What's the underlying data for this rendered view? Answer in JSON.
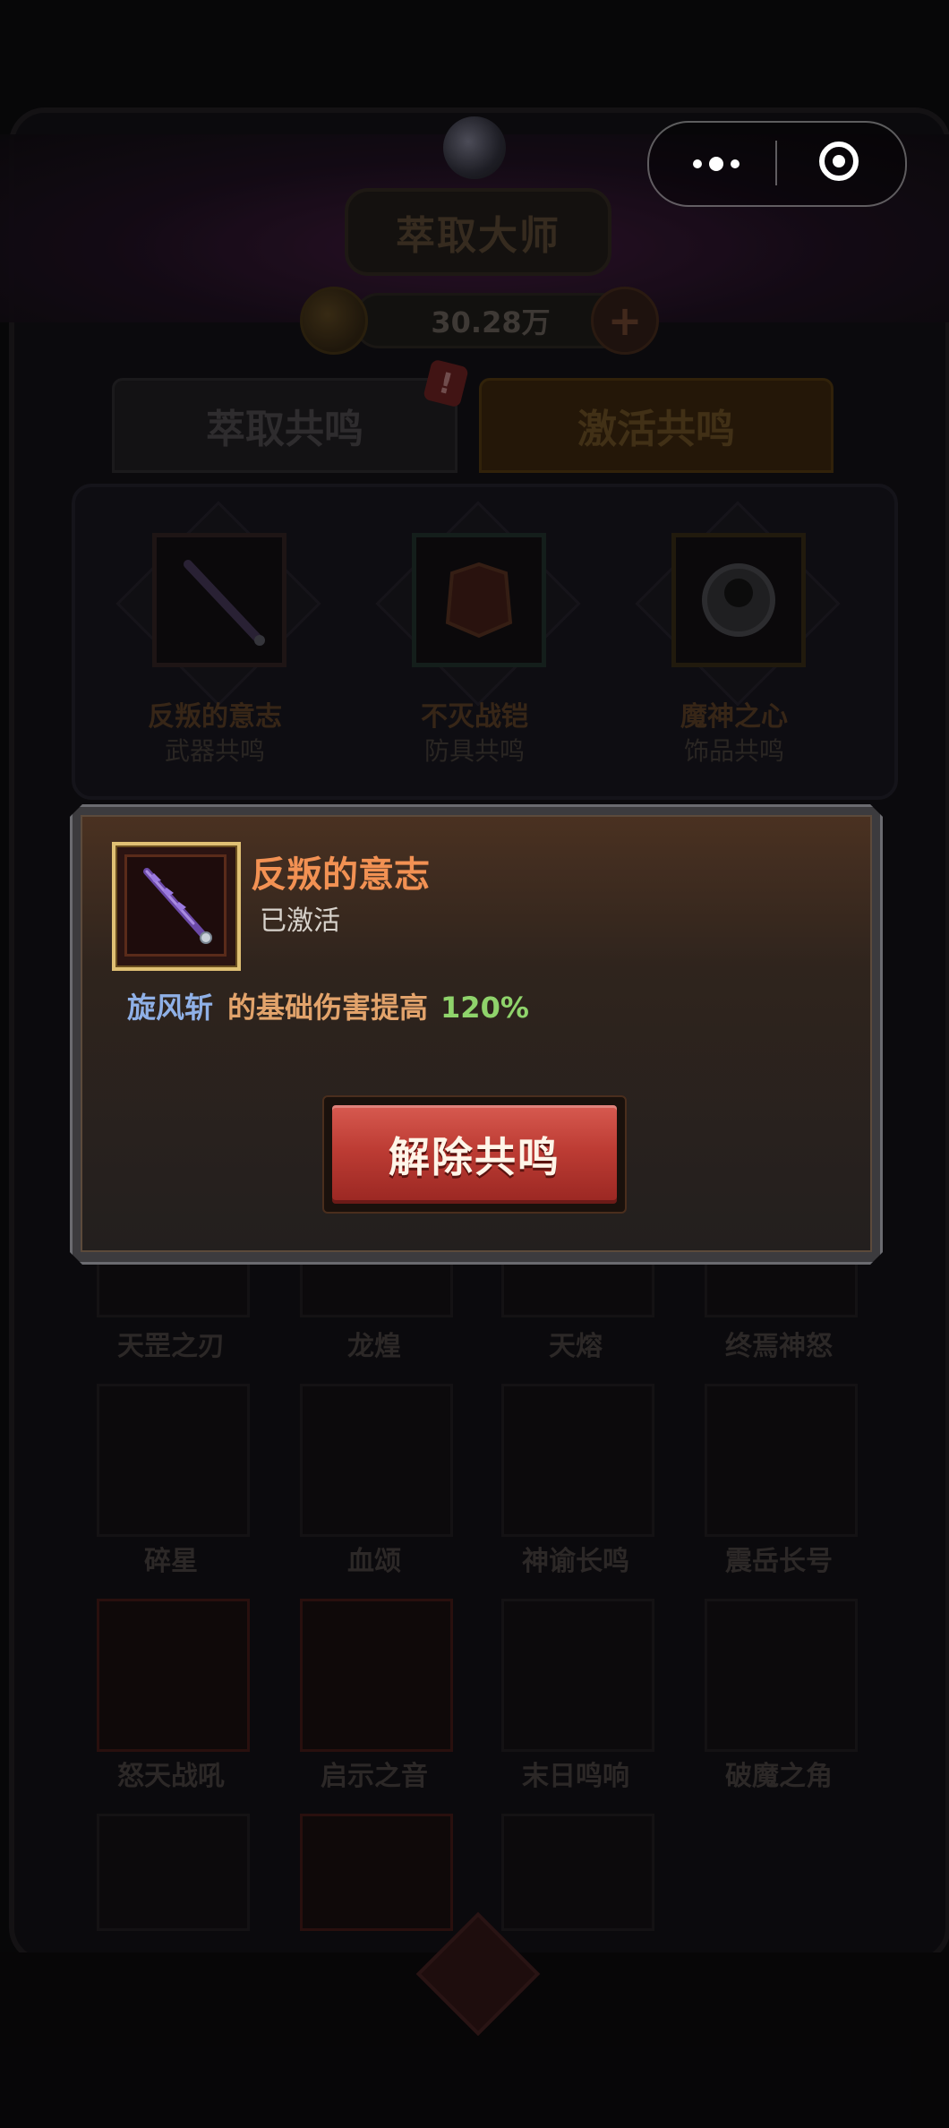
{
  "header": {
    "title": "萃取大师",
    "currency_amount": "30.28万",
    "plus_symbol": "+"
  },
  "tabs": [
    {
      "label": "萃取共鸣"
    },
    {
      "label": "激活共鸣"
    }
  ],
  "tab_badge": "!",
  "resonance_slots": [
    {
      "name": "反叛的意志",
      "type": "武器共鸣"
    },
    {
      "name": "不灭战铠",
      "type": "防具共鸣"
    },
    {
      "name": "魔神之心",
      "type": "饰品共鸣"
    }
  ],
  "grid_items": [
    {
      "name": "天罡之刃"
    },
    {
      "name": "龙煌"
    },
    {
      "name": "天熔"
    },
    {
      "name": "终焉神怒"
    },
    {
      "name": "碎星"
    },
    {
      "name": "血颂"
    },
    {
      "name": "神谕长鸣"
    },
    {
      "name": "震岳长号"
    },
    {
      "name": "怒天战吼"
    },
    {
      "name": "启示之音"
    },
    {
      "name": "末日鸣响"
    },
    {
      "name": "破魔之角"
    }
  ],
  "modal": {
    "item_name": "反叛的意志",
    "status": "已激活",
    "skill": "旋风斩",
    "effect_text": "的基础伤害提高",
    "effect_value": "120%",
    "button_label": "解除共鸣"
  },
  "colors": {
    "title_orange": "#f29153",
    "skill_blue": "#8fb0e6",
    "value_green": "#8fd36b",
    "button_red": "#bd3c34",
    "frame_gold": "#e0c074"
  }
}
